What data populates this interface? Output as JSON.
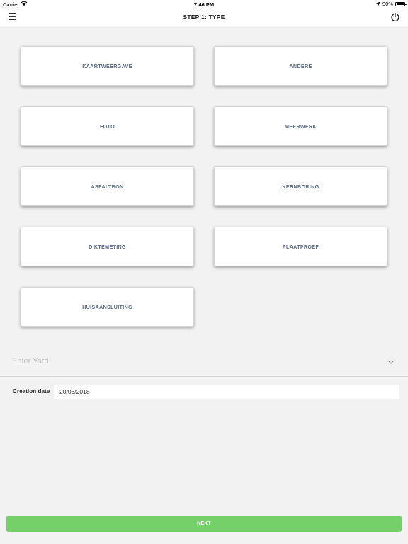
{
  "status_bar": {
    "carrier": "Carrier",
    "time": "7:46 PM",
    "battery_percent": "90%",
    "battery_level": 0.9,
    "icons": [
      "wifi-icon",
      "location-arrow-icon",
      "battery-icon"
    ]
  },
  "nav": {
    "title": "STEP 1: TYPE",
    "left_icon": "hamburger-menu-icon",
    "right_icon": "power-icon"
  },
  "types": [
    {
      "label": "KAARTWEERGAVE"
    },
    {
      "label": "ANDERE"
    },
    {
      "label": "FOTO"
    },
    {
      "label": "MEERWERK"
    },
    {
      "label": "ASFALTBON"
    },
    {
      "label": "KERNBORING"
    },
    {
      "label": "DIKTEMETING"
    },
    {
      "label": "PLAATPROEF"
    },
    {
      "label": "HUISAANSLUITING"
    }
  ],
  "yard": {
    "placeholder": "Enter Yard",
    "icon": "chevron-down-icon"
  },
  "creation_date": {
    "label": "Creation date",
    "value": "20/06/2018"
  },
  "next_button": {
    "label": "NEXT",
    "color": "#76d06a"
  },
  "colors": {
    "background": "#f2f2f2",
    "tile_text": "#5a6b87",
    "accent": "#76d06a"
  }
}
